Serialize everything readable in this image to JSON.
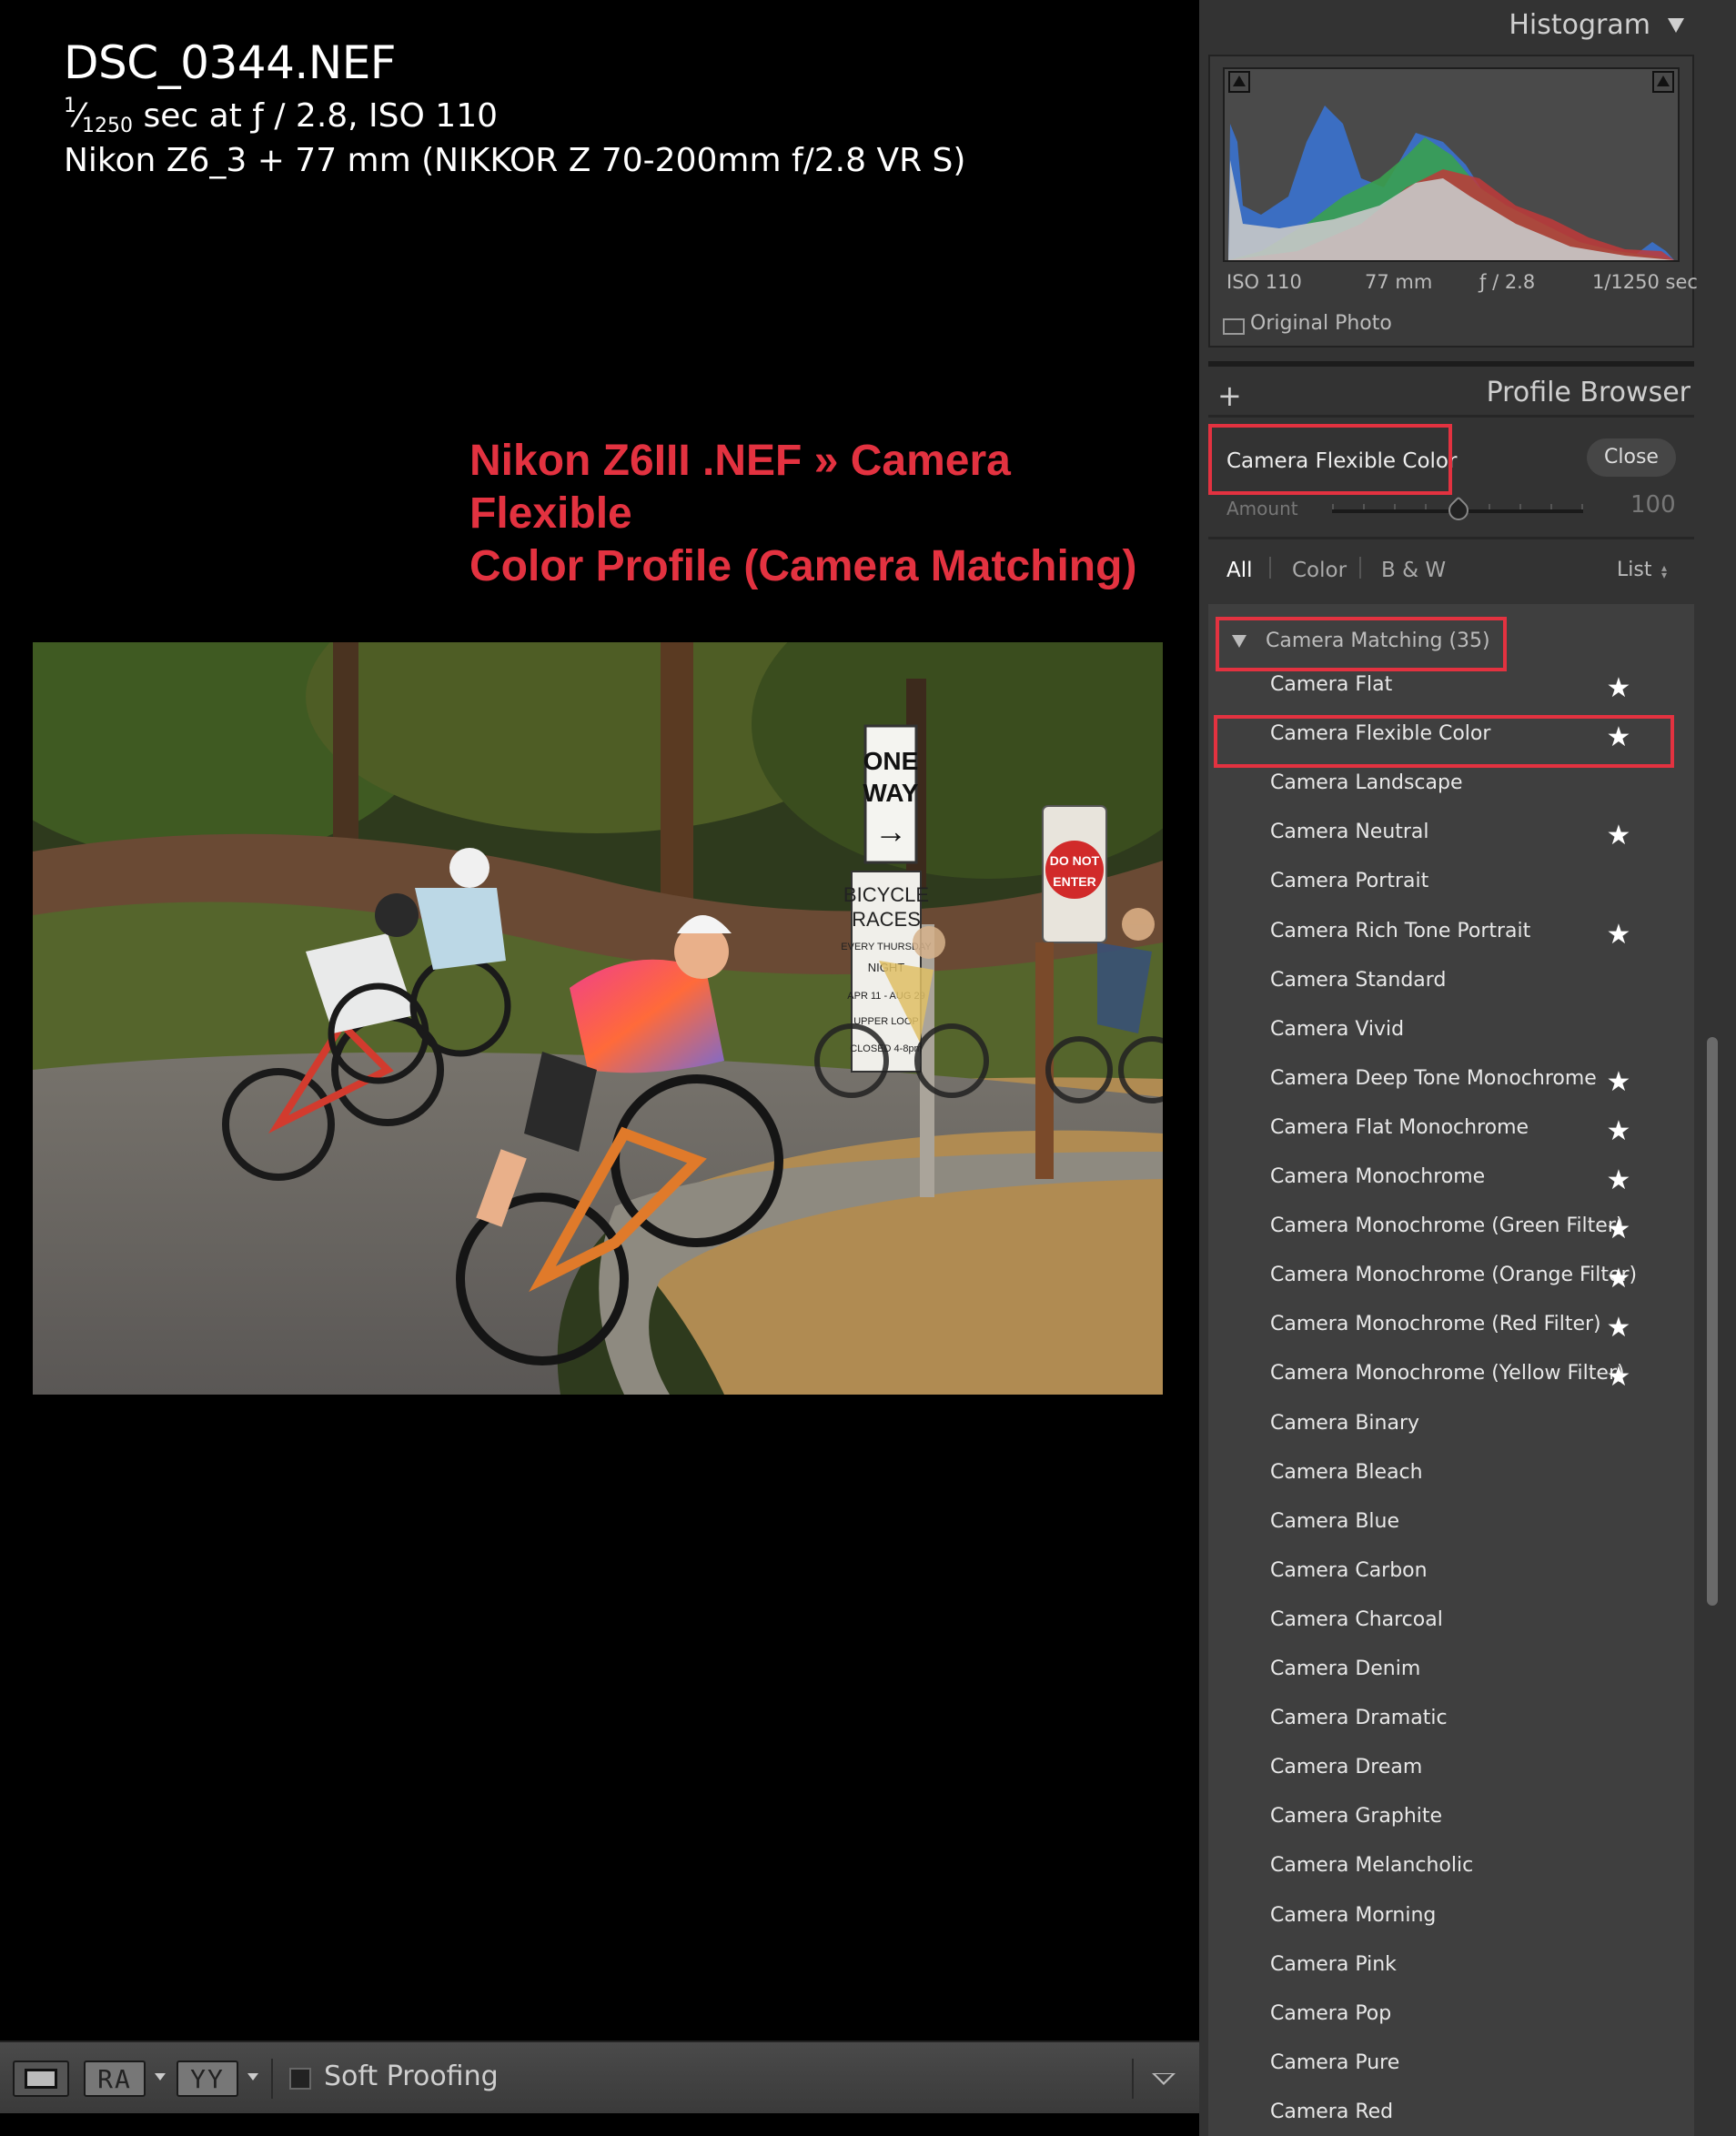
{
  "photo_info": {
    "filename": "DSC_0344.NEF",
    "shutter_numerator": "1",
    "shutter_denominator": "1250",
    "exposure_rest": " sec at ƒ / 2.8, ISO 110",
    "camera_lens": "Nikon Z6_3 + 77 mm (NIKKOR Z 70-200mm f/2.8 VR S)"
  },
  "annotation": {
    "line1": "Nikon Z6III .NEF » Camera Flexible",
    "line2": "Color Profile (Camera Matching)",
    "color": "#e33240"
  },
  "photo": {
    "signs": [
      "ONE",
      "WAY",
      "BICYCLE",
      "RACES",
      "EVERY THURSDAY",
      "NIGHT",
      "APR 11 - AUG 29",
      "UPPER LOOP",
      "CLOSED 4-8pm",
      "DO NOT",
      "ENTER"
    ]
  },
  "toolbar": {
    "view_ra": "RA",
    "view_yy": "YY",
    "soft_proofing": "Soft Proofing"
  },
  "histogram": {
    "title": "Histogram",
    "iso": "ISO 110",
    "focal": "77 mm",
    "aperture": "ƒ / 2.8",
    "shutter": "1/1250 sec",
    "original_photo": "Original Photo"
  },
  "profile_browser": {
    "title": "Profile Browser",
    "add_icon": "+",
    "current_profile": "Camera Flexible Color",
    "close_label": "Close",
    "amount_label": "Amount",
    "amount_value": "100",
    "amount_fraction": 0.5,
    "filters": [
      "All",
      "Color",
      "B & W"
    ],
    "list_label": "List",
    "group_label": "Camera Matching (35)",
    "profiles": [
      {
        "name": "Camera Flat",
        "favorite": true
      },
      {
        "name": "Camera Flexible Color",
        "favorite": true
      },
      {
        "name": "Camera Landscape",
        "favorite": false
      },
      {
        "name": "Camera Neutral",
        "favorite": true
      },
      {
        "name": "Camera Portrait",
        "favorite": false
      },
      {
        "name": "Camera Rich Tone Portrait",
        "favorite": true
      },
      {
        "name": "Camera Standard",
        "favorite": false
      },
      {
        "name": "Camera Vivid",
        "favorite": false
      },
      {
        "name": "Camera Deep Tone Monochrome",
        "favorite": true
      },
      {
        "name": "Camera Flat Monochrome",
        "favorite": true
      },
      {
        "name": "Camera Monochrome",
        "favorite": true
      },
      {
        "name": "Camera Monochrome (Green Filter)",
        "favorite": true
      },
      {
        "name": "Camera Monochrome (Orange Filter)",
        "favorite": true
      },
      {
        "name": "Camera Monochrome (Red Filter)",
        "favorite": true
      },
      {
        "name": "Camera Monochrome (Yellow Filter)",
        "favorite": true
      },
      {
        "name": "Camera Binary",
        "favorite": false
      },
      {
        "name": "Camera Bleach",
        "favorite": false
      },
      {
        "name": "Camera Blue",
        "favorite": false
      },
      {
        "name": "Camera Carbon",
        "favorite": false
      },
      {
        "name": "Camera Charcoal",
        "favorite": false
      },
      {
        "name": "Camera Denim",
        "favorite": false
      },
      {
        "name": "Camera Dramatic",
        "favorite": false
      },
      {
        "name": "Camera Dream",
        "favorite": false
      },
      {
        "name": "Camera Graphite",
        "favorite": false
      },
      {
        "name": "Camera Melancholic",
        "favorite": false
      },
      {
        "name": "Camera Morning",
        "favorite": false
      },
      {
        "name": "Camera Pink",
        "favorite": false
      },
      {
        "name": "Camera Pop",
        "favorite": false
      },
      {
        "name": "Camera Pure",
        "favorite": false
      },
      {
        "name": "Camera Red",
        "favorite": false
      }
    ]
  },
  "colors": {
    "highlight": "#e33240",
    "panel_bg": "#333333",
    "list_bg": "#3f3f3f"
  }
}
